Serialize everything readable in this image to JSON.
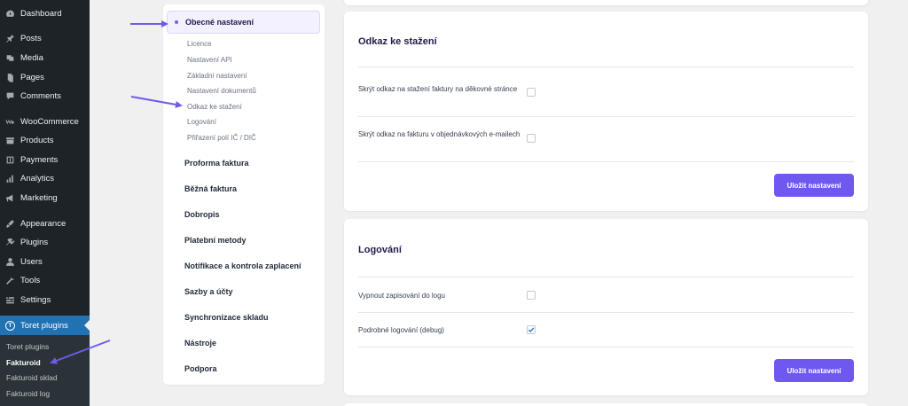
{
  "admin_menu": {
    "items": [
      {
        "label": "Dashboard",
        "icon": "dashboard-icon"
      },
      {
        "label": "Posts",
        "icon": "pin-icon"
      },
      {
        "label": "Media",
        "icon": "media-icon"
      },
      {
        "label": "Pages",
        "icon": "pages-icon"
      },
      {
        "label": "Comments",
        "icon": "comments-icon"
      },
      {
        "label": "WooCommerce",
        "icon": "woocommerce-icon"
      },
      {
        "label": "Products",
        "icon": "products-icon"
      },
      {
        "label": "Payments",
        "icon": "payments-icon"
      },
      {
        "label": "Analytics",
        "icon": "analytics-icon"
      },
      {
        "label": "Marketing",
        "icon": "marketing-icon"
      },
      {
        "label": "Appearance",
        "icon": "appearance-icon"
      },
      {
        "label": "Plugins",
        "icon": "plugins-icon"
      },
      {
        "label": "Users",
        "icon": "users-icon"
      },
      {
        "label": "Tools",
        "icon": "tools-icon"
      },
      {
        "label": "Settings",
        "icon": "settings-icon"
      },
      {
        "label": "Toret plugins",
        "icon": "toret-icon",
        "logo_letter": "T"
      }
    ],
    "submenu": [
      "Toret plugins",
      "Fakturoid",
      "Fakturoid sklad",
      "Fakturoid log"
    ]
  },
  "settings_nav": {
    "active": "Obecné nastavení",
    "sub_items": [
      "Licence",
      "Nastavení API",
      "Základní nastavení",
      "Nastavení dokumentů",
      "Odkaz ke stažení",
      "Logování",
      "Přiřazení polí IČ / DIČ"
    ],
    "main_items": [
      "Proforma faktura",
      "Běžná faktura",
      "Dobropis",
      "Platební metody",
      "Notifikace a kontrola zaplacení",
      "Sazby a účty",
      "Synchronizace skladu",
      "Nástroje",
      "Podpora"
    ]
  },
  "download_card": {
    "title": "Odkaz ke stažení",
    "row1_label": "Skrýt odkaz na stažení faktury na děkovné stránce",
    "row2_label": "Skrýt odkaz na fakturu v objednávkových e-mailech",
    "save_label": "Uložit nastavení"
  },
  "logging_card": {
    "title": "Logování",
    "row1_label": "Vypnout zapisování do logu",
    "row2_label": "Podrobné logování (debug)",
    "row2_checked": true,
    "save_label": "Uložit nastavení"
  },
  "colors": {
    "accent": "#6e58f0",
    "sidebar": "#1d2327",
    "sidebar_active": "#2271b1",
    "annotation_arrow": "#6d5ce8"
  }
}
